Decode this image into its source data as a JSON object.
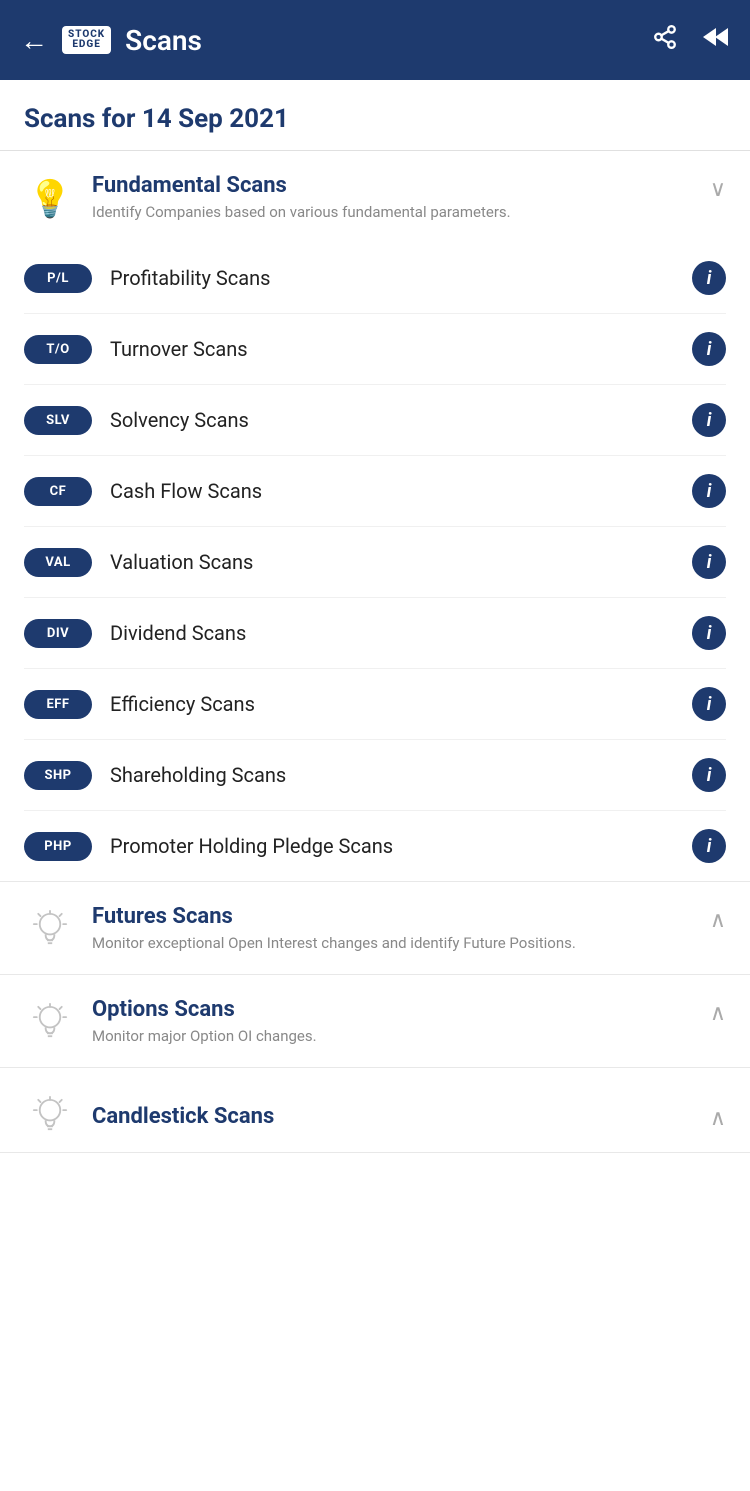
{
  "header": {
    "back_label": "←",
    "logo_top": "STOCK",
    "logo_bottom": "EDGE",
    "title": "Scans",
    "share_icon": "share",
    "rewind_icon": "rewind"
  },
  "page_title": "Scans for 14 Sep 2021",
  "fundamental_section": {
    "title": "Fundamental Scans",
    "description": "Identify Companies based on various fundamental parameters.",
    "chevron": "∨",
    "items": [
      {
        "badge": "P/L",
        "label": "Profitability Scans"
      },
      {
        "badge": "T/O",
        "label": "Turnover Scans"
      },
      {
        "badge": "SLV",
        "label": "Solvency Scans"
      },
      {
        "badge": "CF",
        "label": "Cash Flow Scans"
      },
      {
        "badge": "VAL",
        "label": "Valuation Scans"
      },
      {
        "badge": "DIV",
        "label": "Dividend Scans"
      },
      {
        "badge": "EFF",
        "label": "Efficiency Scans"
      },
      {
        "badge": "SHP",
        "label": "Shareholding Scans"
      },
      {
        "badge": "PHP",
        "label": "Promoter Holding Pledge Scans"
      }
    ]
  },
  "futures_section": {
    "title": "Futures Scans",
    "description": "Monitor exceptional Open Interest changes and identify Future Positions.",
    "chevron": "∧"
  },
  "options_section": {
    "title": "Options Scans",
    "description": "Monitor major Option OI changes.",
    "chevron": "∧"
  },
  "candlestick_section": {
    "title": "Candlestick Scans",
    "chevron": "∧"
  },
  "info_label": "i"
}
